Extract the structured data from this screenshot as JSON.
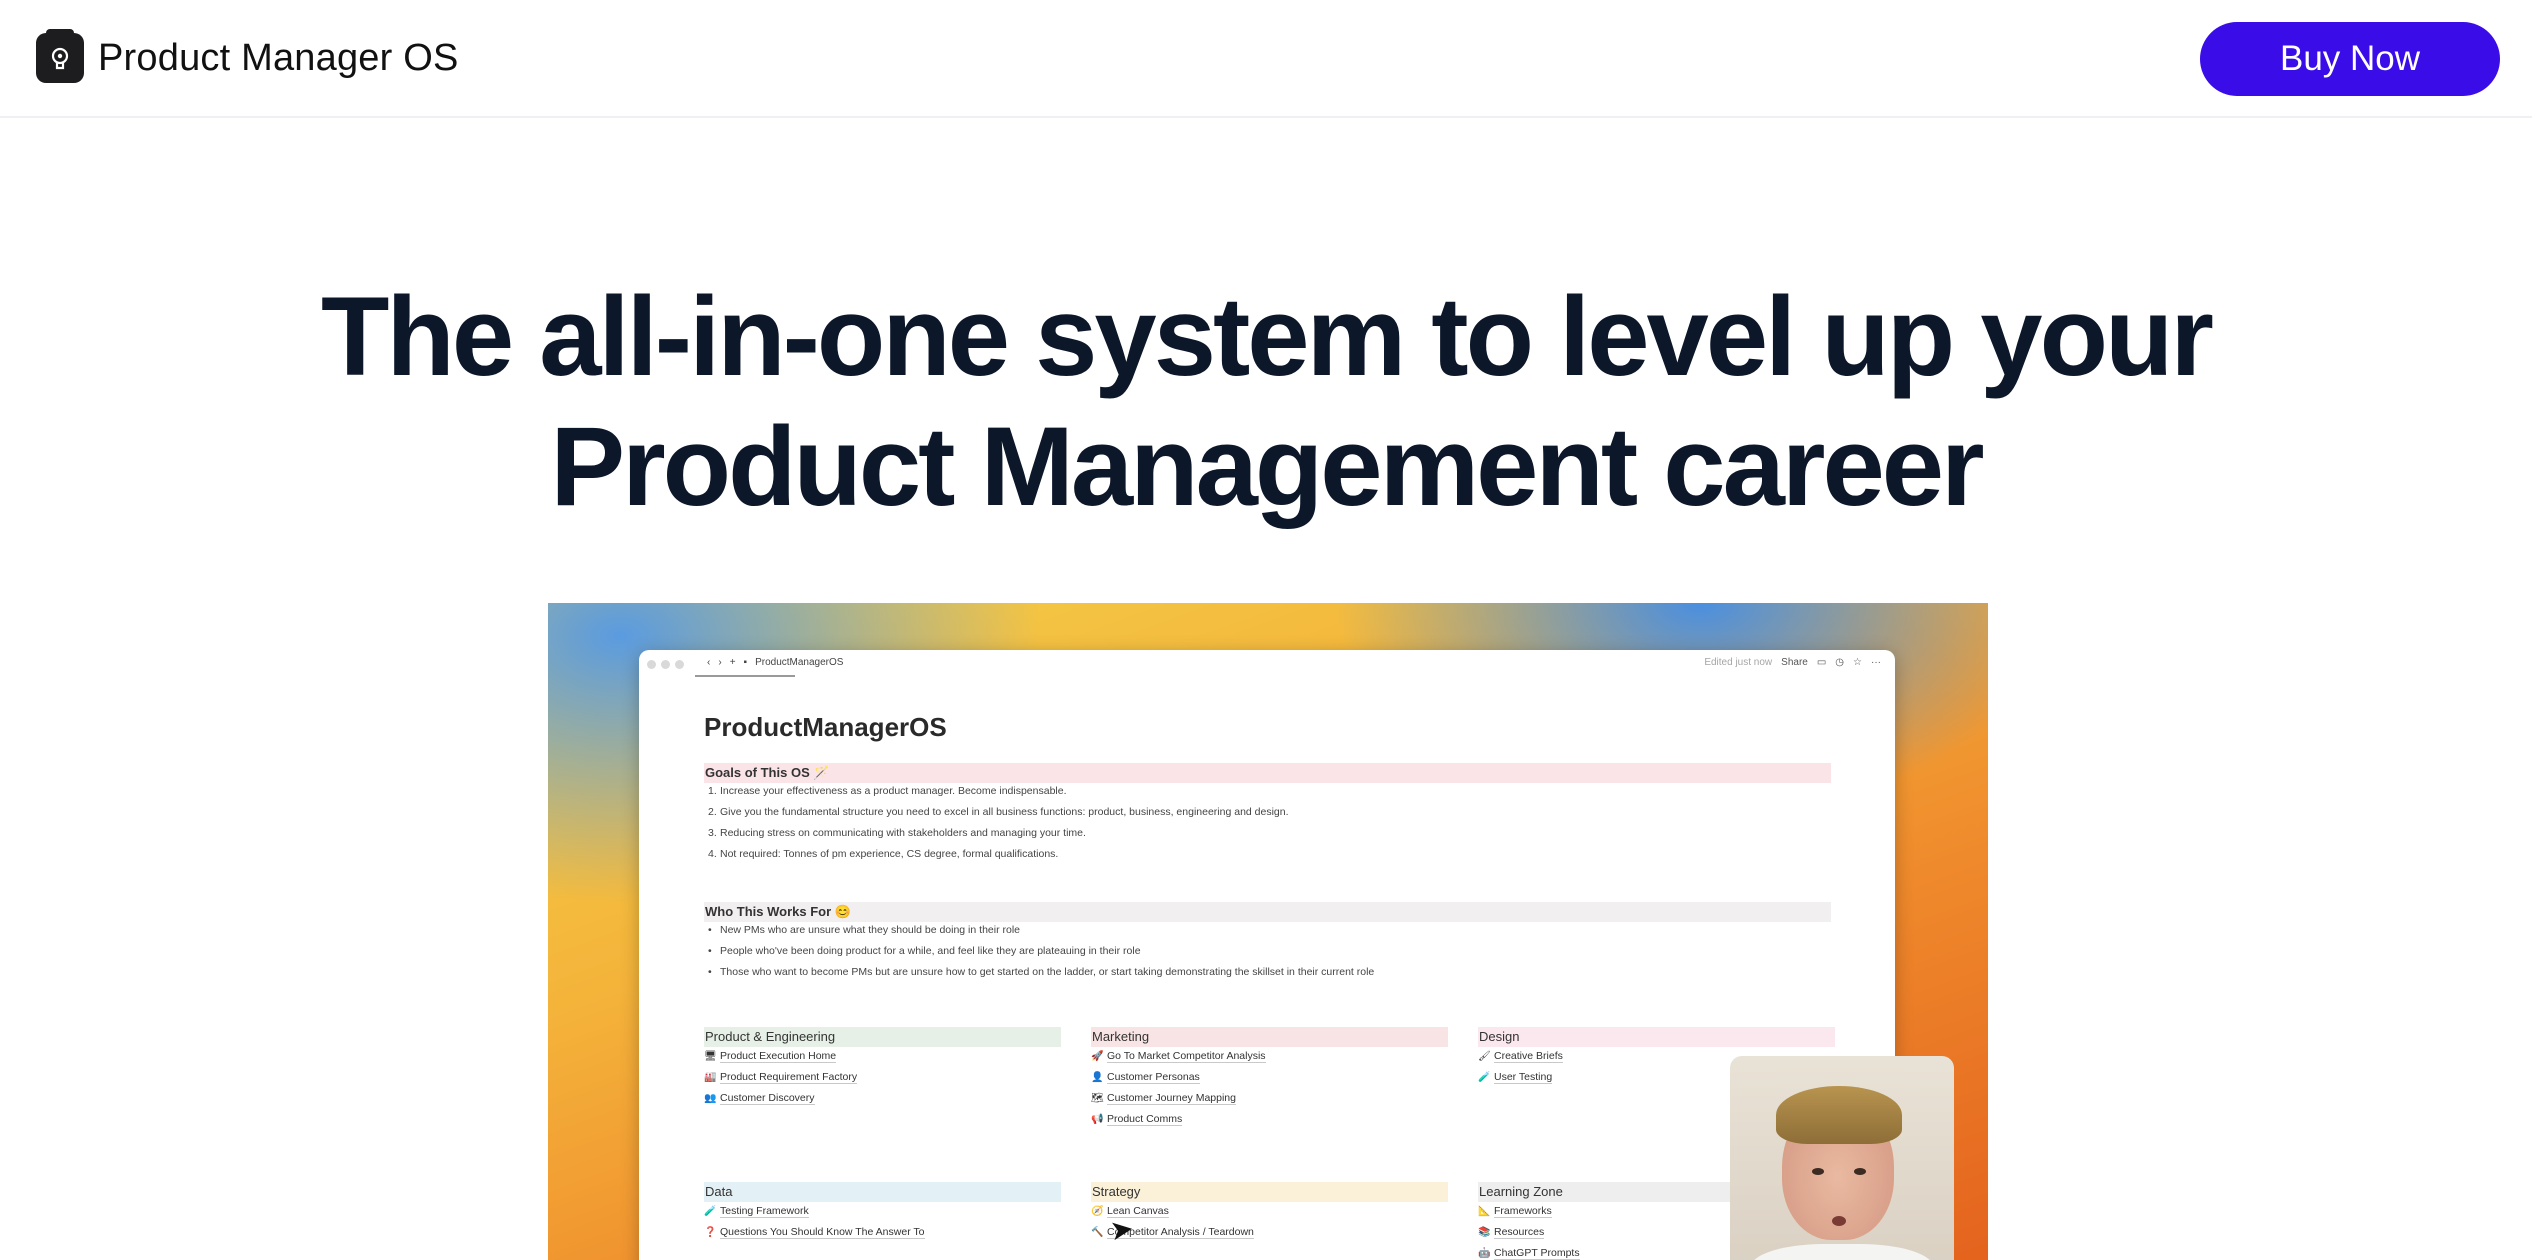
{
  "nav": {
    "brand_name": "Product Manager OS",
    "buy_label": "Buy Now",
    "accent": "#3a0ce8"
  },
  "hero": {
    "line1": "The all-in-one system to level up your",
    "line2": "Product Management career"
  },
  "preview": {
    "breadcrumb": "ProductManagerOS",
    "edited": "Edited just now",
    "share": "Share",
    "doc_title": "ProductManagerOS",
    "goals": {
      "heading": "Goals of This OS 🪄",
      "items": [
        "Increase your effectiveness as a product manager. Become indispensable.",
        "Give you the fundamental structure you need to excel in all business functions: product, business, engineering and design.",
        "Reducing stress on communicating with stakeholders and managing your time.",
        "Not required: Tonnes of pm experience, CS degree, formal qualifications."
      ]
    },
    "who": {
      "heading": "Who This Works For 😊",
      "items": [
        "New PMs who are unsure what they should be doing in their role",
        "People who've been doing product for a while, and feel like they are plateauing in their role",
        "Those who want to become PMs but are unsure how to get started on the ladder, or start taking demonstrating the skillset in their current role"
      ]
    },
    "categories": {
      "pe": {
        "title": "Product & Engineering",
        "links": [
          "Product Execution Home",
          "Product Requirement Factory",
          "Customer Discovery"
        ],
        "icons": [
          "🖥",
          "🏭",
          "👥"
        ]
      },
      "mk": {
        "title": "Marketing",
        "links": [
          "Go To Market Competitor Analysis",
          "Customer Personas",
          "Customer Journey Mapping",
          "Product Comms"
        ],
        "icons": [
          "🚀",
          "👤",
          "🗺",
          "📢"
        ]
      },
      "ds": {
        "title": "Design",
        "links": [
          "Creative Briefs",
          "User Testing"
        ],
        "icons": [
          "🖌",
          "🧪"
        ]
      },
      "dt": {
        "title": "Data",
        "links": [
          "Testing Framework",
          "Questions You Should Know The Answer To"
        ],
        "icons": [
          "🧪",
          "❓"
        ]
      },
      "st": {
        "title": "Strategy",
        "links": [
          "Lean Canvas",
          "Competitor Analysis / Teardown"
        ],
        "icons": [
          "🧭",
          "🔨"
        ]
      },
      "lz": {
        "title": "Learning Zone",
        "links": [
          "Frameworks",
          "Resources",
          "ChatGPT Prompts"
        ],
        "icons": [
          "📐",
          "📚",
          "🤖"
        ]
      }
    }
  }
}
